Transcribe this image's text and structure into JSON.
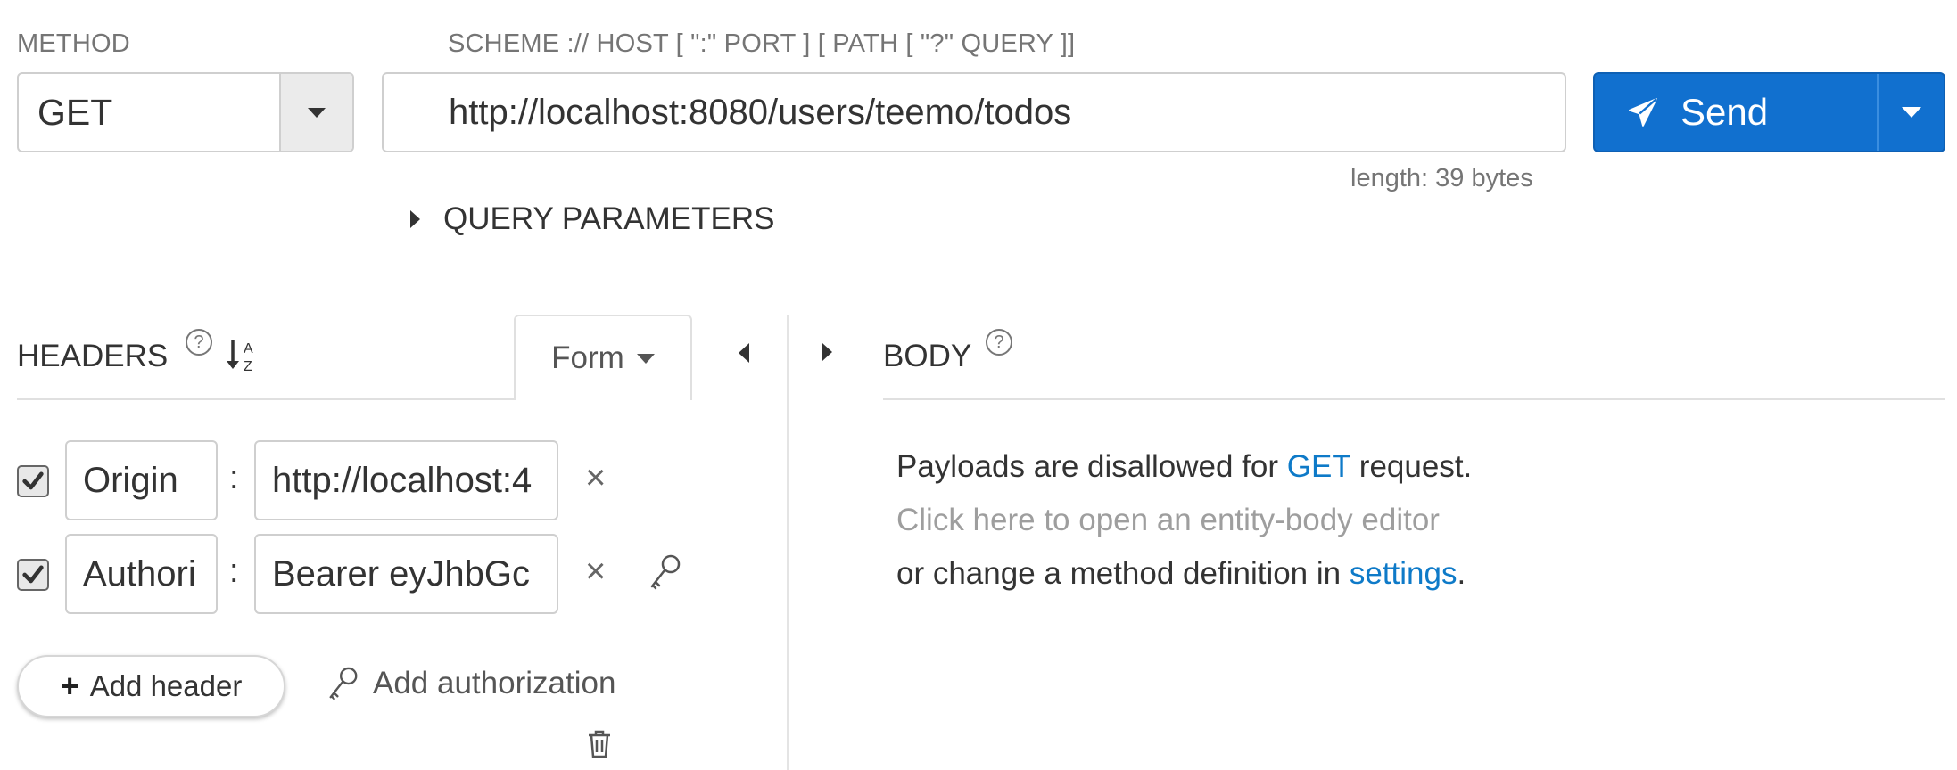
{
  "request": {
    "method_label": "METHOD",
    "method_value": "GET",
    "url_hint": "SCHEME :// HOST [ \":\" PORT ] [ PATH [ \"?\" QUERY ]]",
    "url_value": "http://localhost:8080/users/teemo/todos",
    "send_label": "Send",
    "length_text": "length: 39 bytes",
    "query_params_label": "QUERY PARAMETERS"
  },
  "headers": {
    "title": "HEADERS",
    "help": "?",
    "mode_tab": "Form",
    "rows": [
      {
        "checked": true,
        "name": "Origin",
        "separator": ":",
        "value": "http://localhost:4",
        "remove": "×"
      },
      {
        "checked": true,
        "name": "Authori",
        "separator": ":",
        "value": "Bearer eyJhbGc",
        "remove": "×"
      }
    ],
    "add_header_label": "Add header",
    "add_authorization_label": "Add authorization"
  },
  "body": {
    "title": "BODY",
    "help": "?",
    "line1_pre": "Payloads are disallowed for ",
    "line1_method": "GET",
    "line1_post": " request.",
    "line2": "Click here to open an entity-body editor",
    "line3_pre": "or change a method definition in ",
    "line3_link": "settings",
    "line3_post": "."
  },
  "icons": [
    "caret-down-icon",
    "paper-plane-icon",
    "caret-right-icon",
    "caret-left-icon",
    "help-icon",
    "sort-az-icon",
    "checkbox-icon",
    "close-icon",
    "key-icon",
    "plus-icon",
    "trash-icon"
  ],
  "colors": {
    "accent": "#1170cf",
    "link": "#0e7ac8",
    "muted": "#9e9e9e"
  }
}
